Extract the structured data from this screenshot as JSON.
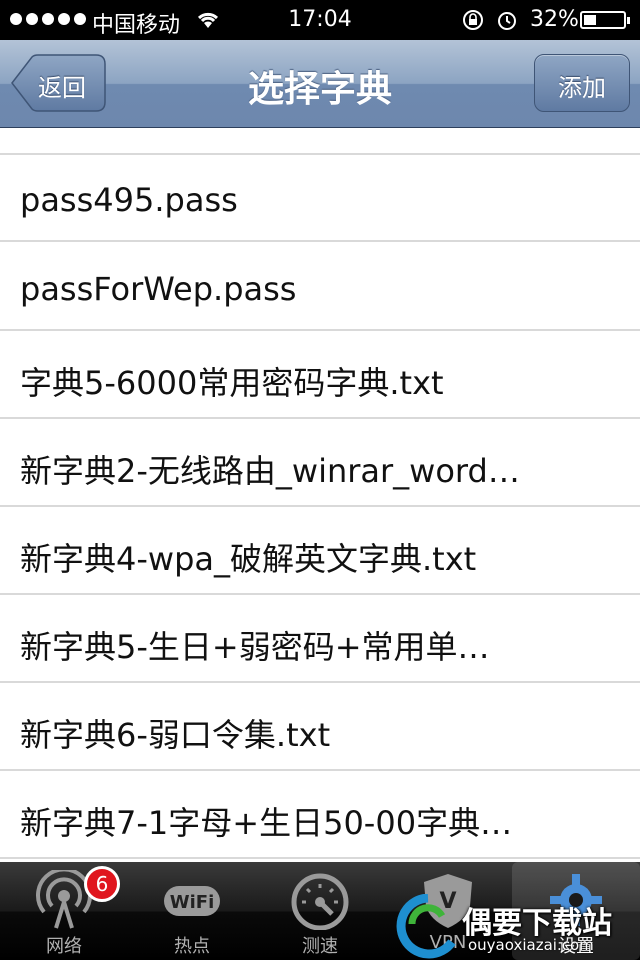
{
  "status_bar": {
    "carrier": "中国移动",
    "time": "17:04",
    "battery_percent_text": "32%",
    "battery_level": 0.32
  },
  "nav": {
    "title": "选择字典",
    "back_label": "返回",
    "add_label": "添加"
  },
  "list": {
    "items": [
      "pass495.pass",
      "passForWep.pass",
      "字典5-6000常用密码字典.txt",
      "新字典2-无线路由_winrar_word…",
      "新字典4-wpa_破解英文字典.txt",
      "新字典5-生日+弱密码+常用单…",
      "新字典6-弱口令集.txt",
      "新字典7-1字母+生日50-00字典…"
    ]
  },
  "tab_bar": {
    "tabs": [
      {
        "label": "网络",
        "icon": "antenna-icon",
        "badge": "6"
      },
      {
        "label": "热点",
        "icon": "wifi-icon"
      },
      {
        "label": "测速",
        "icon": "speedometer-icon"
      },
      {
        "label": "VPN",
        "icon": "vpn-shield-icon"
      },
      {
        "label": "设置",
        "icon": "gear-icon",
        "active": true
      }
    ]
  },
  "watermark": {
    "title": "偶要下载站",
    "subtitle": "ouyaoxiazai.com"
  },
  "colors": {
    "nav_gradient_top": "#b3c3d7",
    "nav_gradient_bottom": "#6d87ad",
    "badge_red": "#e0161e",
    "separator": "#d9d9d9"
  }
}
